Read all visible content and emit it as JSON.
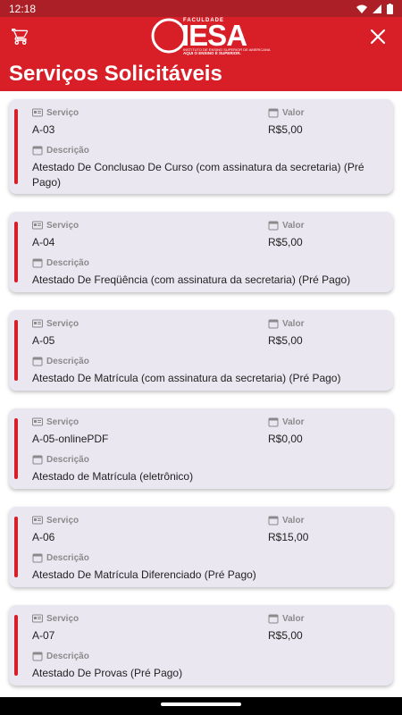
{
  "status": {
    "time": "12:18"
  },
  "header": {
    "logo_top": "FACULDADE",
    "logo_name": "IESA",
    "logo_tagline": "INSTITUTO DE ENSINO SUPERIOR DE AMERICANA",
    "logo_slogan": "AQUI O ENSINO É SUPERIOR.",
    "title": "Serviços Solicitáveis"
  },
  "labels": {
    "service": "Serviço",
    "value": "Valor",
    "description": "Descrição"
  },
  "services": [
    {
      "code": "A-03",
      "price": "R$5,00",
      "description": "Atestado De Conclusao De Curso (com assinatura da secretaria) (Pré Pago)"
    },
    {
      "code": "A-04",
      "price": "R$5,00",
      "description": "Atestado De Freqüência (com assinatura da secretaria) (Pré Pago)"
    },
    {
      "code": "A-05",
      "price": "R$5,00",
      "description": "Atestado De Matrícula (com assinatura da secretaria) (Pré Pago)"
    },
    {
      "code": "A-05-onlinePDF",
      "price": "R$0,00",
      "description": "Atestado de Matrícula (eletrônico)"
    },
    {
      "code": "A-06",
      "price": "R$15,00",
      "description": "Atestado De Matrícula Diferenciado (Pré Pago)"
    },
    {
      "code": "A-07",
      "price": "R$5,00",
      "description": "Atestado De Provas (Pré Pago)"
    }
  ],
  "colors": {
    "brand_red": "#d81e27",
    "card_bg": "#ebe7f1"
  }
}
